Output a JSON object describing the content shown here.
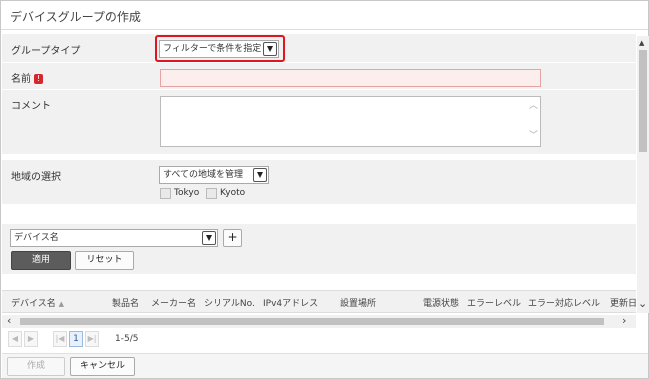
{
  "dialog": {
    "title": "デバイスグループの作成"
  },
  "form": {
    "group_type": {
      "label": "グループタイプ",
      "value": "フィルターで条件を指定"
    },
    "name": {
      "label": "名前",
      "required_mark": "!",
      "value": ""
    },
    "comment": {
      "label": "コメント",
      "value": ""
    },
    "region": {
      "label": "地域の選択",
      "value": "すべての地域を管理",
      "options": [
        {
          "label": "Tokyo",
          "checked": false
        },
        {
          "label": "Kyoto",
          "checked": false
        }
      ]
    }
  },
  "filter": {
    "field_value": "デバイス名",
    "add_label": "+",
    "apply_label": "適用",
    "reset_label": "リセット"
  },
  "table": {
    "columns": [
      "デバイス名",
      "製品名",
      "メーカー名",
      "シリアルNo.",
      "IPv4アドレス",
      "設置場所",
      "電源状態",
      "エラーレベル",
      "エラー対応レベル",
      "更新日"
    ],
    "sort_indicator": "▲"
  },
  "pager": {
    "first": "|◀",
    "prev": "◀",
    "next": "▶",
    "last": "▶|",
    "current_page": "1",
    "range_text": "1-5/5"
  },
  "footer": {
    "create_label": "作成",
    "cancel_label": "キャンセル"
  },
  "colors": {
    "highlight": "#e0151d",
    "required": "#d9262c",
    "name_input_bg": "#fdeeee",
    "name_input_border": "#e6a3a3",
    "page_current": "#e8f1fb"
  }
}
